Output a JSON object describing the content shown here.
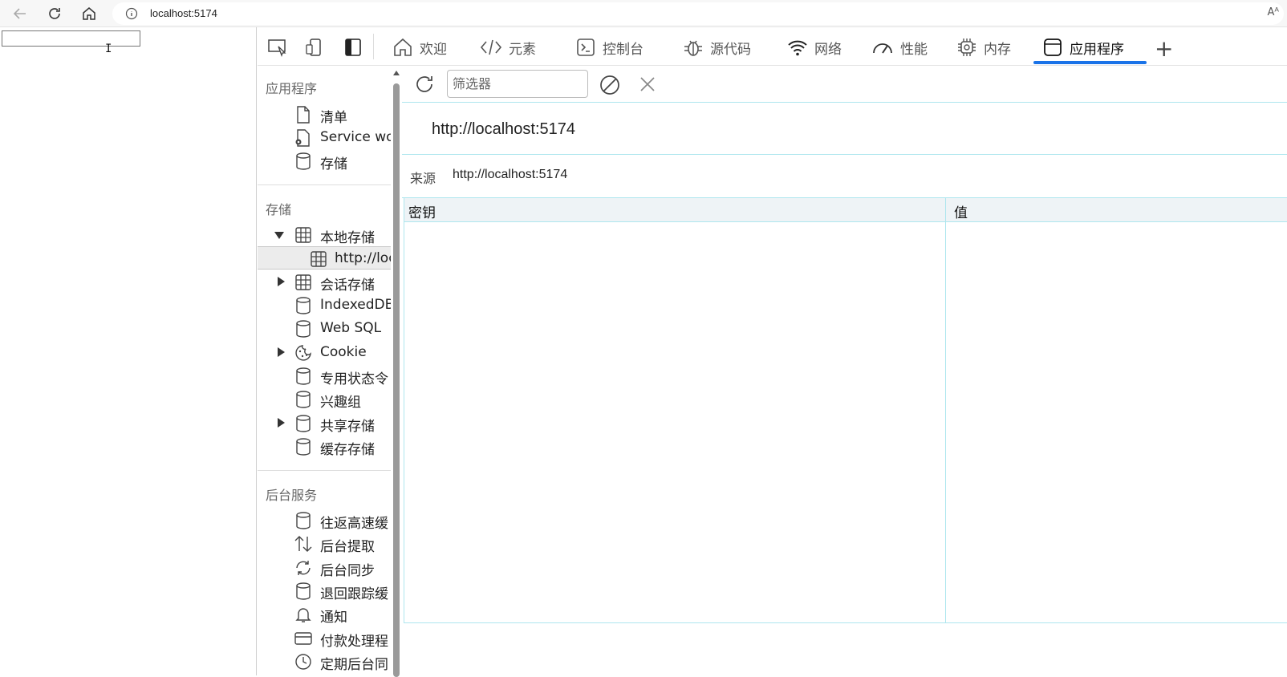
{
  "browser": {
    "address": "localhost:5174",
    "read_aloud_icon": "Aᴬ"
  },
  "devtools": {
    "tabs": [
      {
        "label": "欢迎",
        "icon": "home-icon"
      },
      {
        "label": "元素",
        "icon": "code-icon"
      },
      {
        "label": "控制台",
        "icon": "console-icon"
      },
      {
        "label": "源代码",
        "icon": "bug-icon"
      },
      {
        "label": "网络",
        "icon": "wifi-icon"
      },
      {
        "label": "性能",
        "icon": "gauge-icon"
      },
      {
        "label": "内存",
        "icon": "chip-icon"
      },
      {
        "label": "应用程序",
        "icon": "app-icon",
        "active": true
      }
    ],
    "add_tab": "+"
  },
  "sidebar": {
    "sections": [
      {
        "title": "应用程序",
        "items": [
          {
            "label": "清单",
            "icon": "file-icon"
          },
          {
            "label": "Service wor",
            "icon": "service-worker-icon"
          },
          {
            "label": "存储",
            "icon": "database-icon"
          }
        ]
      },
      {
        "title": "存储",
        "items": [
          {
            "label": "本地存储",
            "icon": "grid-icon",
            "expanded": true
          },
          {
            "label": "http://loc",
            "icon": "grid-icon",
            "selected": true
          },
          {
            "label": "会话存储",
            "icon": "grid-icon",
            "expandable": true
          },
          {
            "label": "IndexedDB",
            "icon": "database-icon"
          },
          {
            "label": "Web SQL",
            "icon": "database-icon"
          },
          {
            "label": "Cookie",
            "icon": "cookie-icon",
            "expandable": true
          },
          {
            "label": "专用状态令",
            "icon": "database-icon"
          },
          {
            "label": "兴趣组",
            "icon": "database-icon"
          },
          {
            "label": "共享存储",
            "icon": "database-icon",
            "expandable": true
          },
          {
            "label": "缓存存储",
            "icon": "database-icon"
          }
        ]
      },
      {
        "title": "后台服务",
        "items": [
          {
            "label": "往返高速缓",
            "icon": "database-icon"
          },
          {
            "label": "后台提取",
            "icon": "updown-arrows-icon"
          },
          {
            "label": "后台同步",
            "icon": "sync-icon"
          },
          {
            "label": "退回跟踪缓",
            "icon": "database-icon"
          },
          {
            "label": "通知",
            "icon": "bell-icon"
          },
          {
            "label": "付款处理程",
            "icon": "card-icon"
          },
          {
            "label": "定期后台同",
            "icon": "clock-icon"
          }
        ]
      }
    ]
  },
  "main": {
    "filter_placeholder": "筛选器",
    "origin_title": "http://localhost:5174",
    "origin_label": "来源",
    "origin_value": "http://localhost:5174",
    "columns": [
      "密钥",
      "值"
    ],
    "rows": []
  },
  "colors": {
    "accent": "#1a73e8",
    "grid_line": "#aee6ee",
    "header_bg": "#eef3f6"
  }
}
